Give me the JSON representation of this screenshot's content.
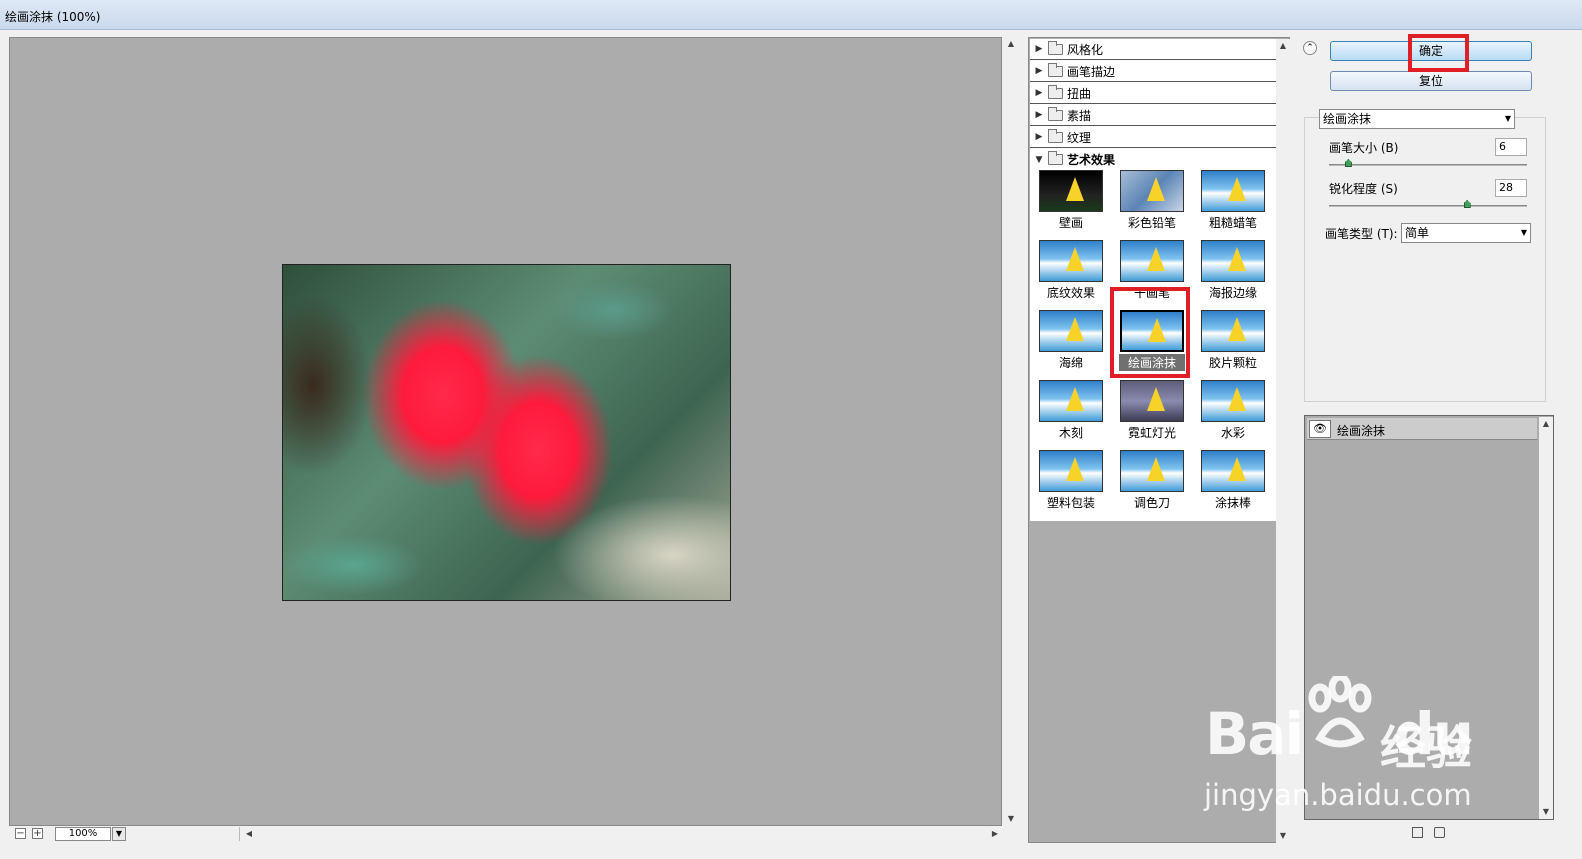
{
  "window": {
    "title": "绘画涂抹 (100%)"
  },
  "preview": {
    "zoom": "100%",
    "zoom_minus": "−",
    "zoom_plus": "+"
  },
  "filters": {
    "categories": [
      {
        "label": "风格化",
        "open": false
      },
      {
        "label": "画笔描边",
        "open": false
      },
      {
        "label": "扭曲",
        "open": false
      },
      {
        "label": "素描",
        "open": false
      },
      {
        "label": "纹理",
        "open": false
      },
      {
        "label": "艺术效果",
        "open": true
      }
    ],
    "items": [
      {
        "label": "壁画",
        "style": "dark"
      },
      {
        "label": "彩色铅笔",
        "style": "sketch"
      },
      {
        "label": "粗糙蜡笔",
        "style": "normal"
      },
      {
        "label": "底纹效果",
        "style": "normal"
      },
      {
        "label": "干画笔",
        "style": "normal"
      },
      {
        "label": "海报边缘",
        "style": "normal"
      },
      {
        "label": "海绵",
        "style": "normal"
      },
      {
        "label": "绘画涂抹",
        "style": "selected"
      },
      {
        "label": "胶片颗粒",
        "style": "normal"
      },
      {
        "label": "木刻",
        "style": "normal"
      },
      {
        "label": "霓虹灯光",
        "style": "neon"
      },
      {
        "label": "水彩",
        "style": "normal"
      },
      {
        "label": "塑料包装",
        "style": "normal"
      },
      {
        "label": "调色刀",
        "style": "normal"
      },
      {
        "label": "涂抹棒",
        "style": "normal"
      }
    ]
  },
  "buttons": {
    "ok": "确定",
    "reset": "复位"
  },
  "settings": {
    "filter_select": "绘画涂抹",
    "brush_size": {
      "label": "画笔大小 (B)",
      "value": "6",
      "fraction": 0.1
    },
    "sharpness": {
      "label": "锐化程度 (S)",
      "value": "28",
      "fraction": 0.7
    },
    "brush_type": {
      "label": "画笔类型 (T):",
      "value": "简单"
    }
  },
  "layers": {
    "items": [
      {
        "name": "绘画涂抹"
      }
    ]
  },
  "colors": {
    "highlight": "#e01e26",
    "canvas": "#acacac"
  }
}
